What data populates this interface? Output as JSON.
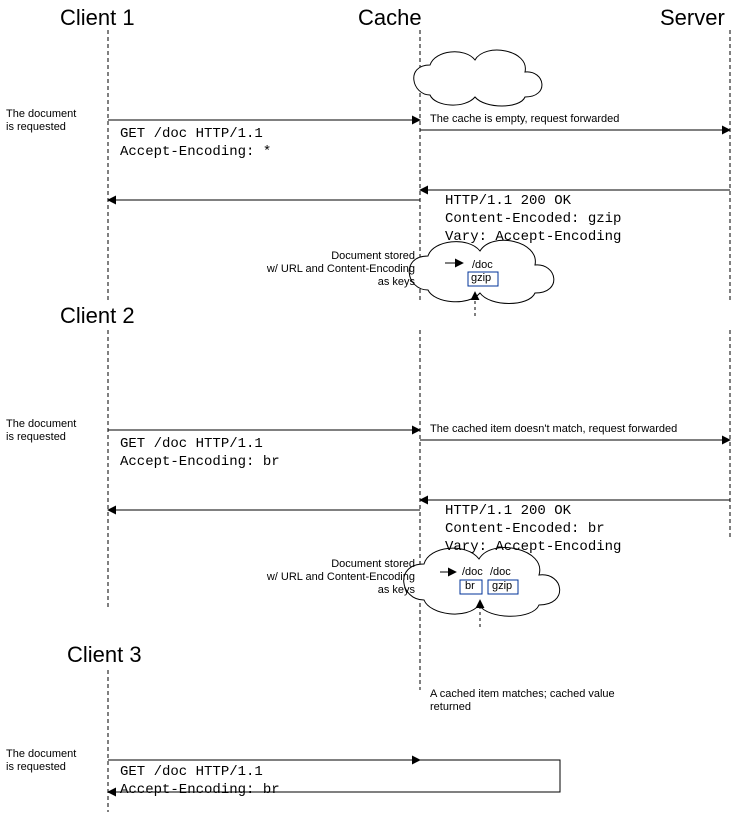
{
  "heads": {
    "client1": "Client 1",
    "cache": "Cache",
    "server": "Server",
    "client2": "Client 2",
    "client3": "Client 3"
  },
  "notes": {
    "doc_req": "The document\nis requested",
    "fwd_empty": "The cache is empty, request forwarded",
    "fwd_nomatch": "The cached item doesn't match, request forwarded",
    "stored": "Document stored\nw/ URL and Content-Encoding\nas keys",
    "cached_match": "A cached item matches; cached value\nreturned"
  },
  "req": {
    "r1": "GET /doc HTTP/1.1\nAccept-Encoding: *",
    "r2": "GET /doc HTTP/1.1\nAccept-Encoding: br",
    "r3": "GET /doc HTTP/1.1\nAccept-Encoding: br"
  },
  "resp": {
    "p1": "HTTP/1.1 200 OK\nContent-Encoded: gzip\nVary: Accept-Encoding",
    "p2": "HTTP/1.1 200 OK\nContent-Encoded: br\nVary: Accept-Encoding"
  },
  "cache": {
    "doc": "/doc",
    "gzip": "gzip",
    "br": "br"
  }
}
